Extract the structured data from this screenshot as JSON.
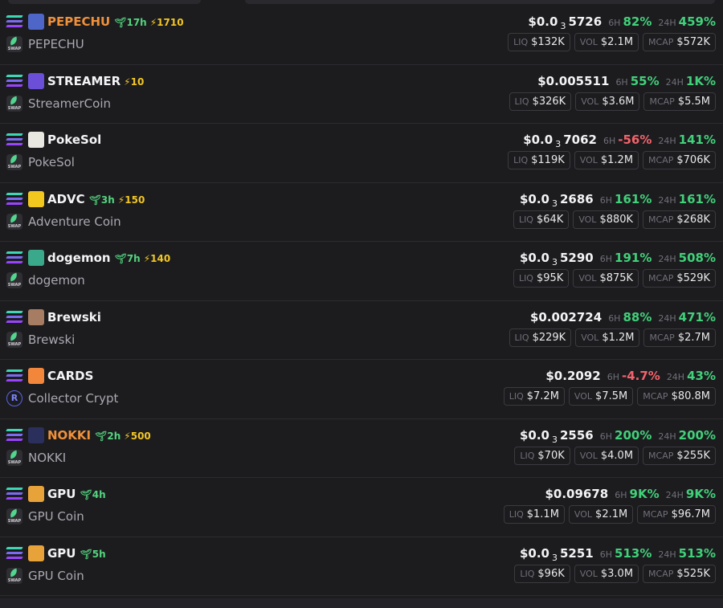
{
  "labels": {
    "h6": "6H",
    "h24": "24H",
    "liq": "LIQ",
    "vol": "VOL",
    "mcap": "MCAP"
  },
  "colors": {
    "up": "#41d17a",
    "down": "#f2636b",
    "age": "#54d47e",
    "bolt": "#f3c623",
    "highlight_symbol": "#f0913a"
  },
  "rows": [
    {
      "symbol": "PEPECHU",
      "symbol_color": "#f0913a",
      "icon": "pepechu-token-icon",
      "icon_color": "#4f66c9",
      "age": "17h",
      "boost": "1710",
      "dex": "swap",
      "name": "PEPECHU",
      "price_pre": "$0.0",
      "price_sub": "3",
      "price_post": "5726",
      "c6": "82%",
      "c6dir": "up",
      "c24": "459%",
      "c24dir": "up",
      "liq": "$132K",
      "vol": "$2.1M",
      "mcap": "$572K"
    },
    {
      "symbol": "STREAMER",
      "symbol_color": "#f4f4f6",
      "icon": "streamer-token-icon",
      "icon_color": "#6b4fd8",
      "age": "",
      "boost": "10",
      "dex": "swap",
      "name": "StreamerCoin",
      "price_pre": "$0.005511",
      "price_sub": "",
      "price_post": "",
      "c6": "55%",
      "c6dir": "up",
      "c24": "1K%",
      "c24dir": "up",
      "liq": "$326K",
      "vol": "$3.6M",
      "mcap": "$5.5M"
    },
    {
      "symbol": "PokeSol",
      "symbol_color": "#f4f4f6",
      "icon": "pokesol-token-icon",
      "icon_color": "#e8e8e0",
      "age": "",
      "boost": "",
      "dex": "swap",
      "name": "PokeSol",
      "price_pre": "$0.0",
      "price_sub": "3",
      "price_post": "7062",
      "c6": "-56%",
      "c6dir": "down",
      "c24": "141%",
      "c24dir": "up",
      "liq": "$119K",
      "vol": "$1.2M",
      "mcap": "$706K"
    },
    {
      "symbol": "ADVC",
      "symbol_color": "#f4f4f6",
      "icon": "advc-token-icon",
      "icon_color": "#f2c81f",
      "age": "3h",
      "boost": "150",
      "dex": "swap",
      "name": "Adventure Coin",
      "price_pre": "$0.0",
      "price_sub": "3",
      "price_post": "2686",
      "c6": "161%",
      "c6dir": "up",
      "c24": "161%",
      "c24dir": "up",
      "liq": "$64K",
      "vol": "$880K",
      "mcap": "$268K"
    },
    {
      "symbol": "dogemon",
      "symbol_color": "#f4f4f6",
      "icon": "dogemon-token-icon",
      "icon_color": "#3aa88a",
      "age": "7h",
      "boost": "140",
      "dex": "swap",
      "name": "dogemon",
      "price_pre": "$0.0",
      "price_sub": "3",
      "price_post": "5290",
      "c6": "191%",
      "c6dir": "up",
      "c24": "508%",
      "c24dir": "up",
      "liq": "$95K",
      "vol": "$875K",
      "mcap": "$529K"
    },
    {
      "symbol": "Brewski",
      "symbol_color": "#f4f4f6",
      "icon": "brewski-token-icon",
      "icon_color": "#a67c62",
      "age": "",
      "boost": "",
      "dex": "swap",
      "name": "Brewski",
      "price_pre": "$0.002724",
      "price_sub": "",
      "price_post": "",
      "c6": "88%",
      "c6dir": "up",
      "c24": "471%",
      "c24dir": "up",
      "liq": "$229K",
      "vol": "$1.2M",
      "mcap": "$2.7M"
    },
    {
      "symbol": "CARDS",
      "symbol_color": "#f4f4f6",
      "icon": "cards-token-icon",
      "icon_color": "#f2863a",
      "age": "",
      "boost": "",
      "dex": "raydium",
      "name": "Collector Crypt",
      "price_pre": "$0.2092",
      "price_sub": "",
      "price_post": "",
      "c6": "-4.7%",
      "c6dir": "down",
      "c24": "43%",
      "c24dir": "up",
      "liq": "$7.2M",
      "vol": "$7.5M",
      "mcap": "$80.8M"
    },
    {
      "symbol": "NOKKI",
      "symbol_color": "#f0913a",
      "icon": "nokki-token-icon",
      "icon_color": "#2a2f5c",
      "age": "2h",
      "boost": "500",
      "dex": "swap",
      "name": "NOKKI",
      "price_pre": "$0.0",
      "price_sub": "3",
      "price_post": "2556",
      "c6": "200%",
      "c6dir": "up",
      "c24": "200%",
      "c24dir": "up",
      "liq": "$70K",
      "vol": "$4.0M",
      "mcap": "$255K"
    },
    {
      "symbol": "GPU",
      "symbol_color": "#f4f4f6",
      "icon": "gpu-token-icon",
      "icon_color": "#e8a23a",
      "age": "4h",
      "boost": "",
      "dex": "swap",
      "name": "GPU Coin",
      "price_pre": "$0.09678",
      "price_sub": "",
      "price_post": "",
      "c6": "9K%",
      "c6dir": "up",
      "c24": "9K%",
      "c24dir": "up",
      "liq": "$1.1M",
      "vol": "$2.1M",
      "mcap": "$96.7M"
    },
    {
      "symbol": "GPU",
      "symbol_color": "#f4f4f6",
      "icon": "gpu-token-icon",
      "icon_color": "#e8a23a",
      "age": "5h",
      "boost": "",
      "dex": "swap",
      "name": "GPU Coin",
      "price_pre": "$0.0",
      "price_sub": "3",
      "price_post": "5251",
      "c6": "513%",
      "c6dir": "up",
      "c24": "513%",
      "c24dir": "up",
      "liq": "$96K",
      "vol": "$3.0M",
      "mcap": "$525K"
    }
  ]
}
